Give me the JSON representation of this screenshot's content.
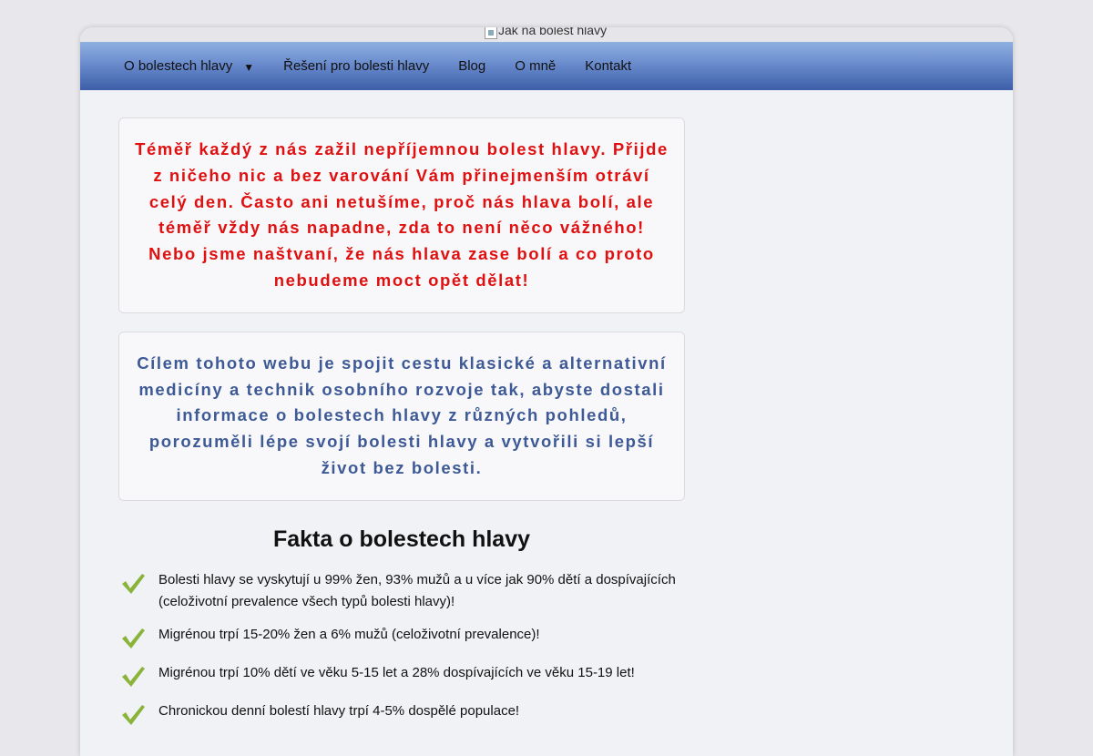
{
  "header": {
    "logo_alt": "Jak na bolest hlavy"
  },
  "nav": {
    "items": [
      {
        "label": "O bolestech hlavy",
        "has_dropdown": true
      },
      {
        "label": "Řešení pro bolesti hlavy"
      },
      {
        "label": "Blog"
      },
      {
        "label": "O mně"
      },
      {
        "label": "Kontakt"
      }
    ],
    "dropdown_glyph": "▼"
  },
  "intro": {
    "text": "Téměř každý z nás zažil nepříjemnou bolest hlavy. Přijde z ničeho nic a bez varování Vám přinejmenším otráví celý den. Často ani netušíme, proč nás hlava bolí, ale téměř vždy nás napadne, zda to není něco vážného! Nebo jsme naštvaní, že nás hlava zase bolí a co proto nebudeme moct opět dělat!",
    "color": "#e01010"
  },
  "mission": {
    "text": "Cílem tohoto webu je spojit cestu klasické a alternativní medicíny a technik osobního rozvoje tak, abyste dostali informace o bolestech hlavy z různých pohledů, porozuměli lépe svojí bolesti hlavy a vytvořili si lepší život bez bolesti.",
    "color": "#3e5a96"
  },
  "facts": {
    "title": "Fakta o bolestech hlavy",
    "icon": "checkmark-icon",
    "check_color": "#8ab33a",
    "items": [
      "Bolesti hlavy se vyskytují u 99% žen, 93% mužů a u více jak 90% dětí a dospívajících (celoživotní prevalence všech typů bolesti hlavy)!",
      "Migrénou trpí 15-20% žen a 6% mužů (celoživotní prevalence)!",
      "Migrénou trpí 10% dětí ve věku 5-15 let a 28% dospívajících ve věku 15-19 let!",
      "Chronickou denní bolestí hlavy trpí 4-5% dospělé populace!"
    ]
  }
}
